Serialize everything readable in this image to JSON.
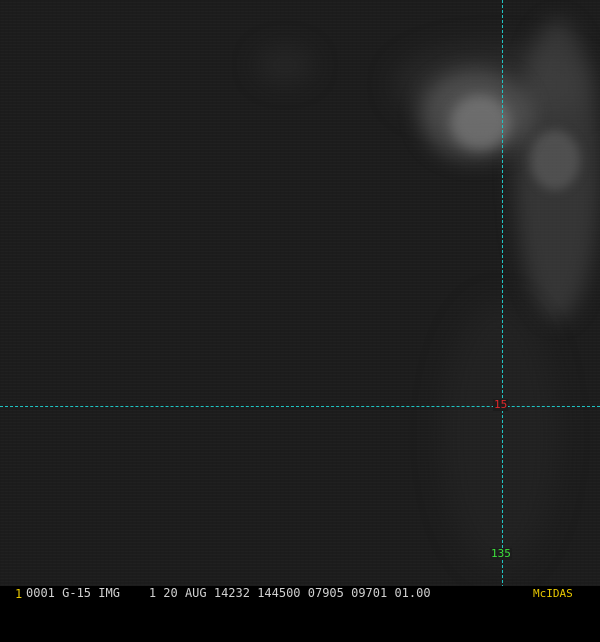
{
  "image": {
    "type": "satellite-imagery",
    "colors": {
      "background": "#1c1c1c",
      "grid_line": "#1fc4c4",
      "latitude_label": "#e0282a",
      "longitude_label": "#3ce03c",
      "frame_number": "#e8c800",
      "brand": "#e8c800"
    }
  },
  "grid": {
    "latitude_label": "15",
    "longitude_label": "135"
  },
  "status_bar": {
    "frame_number": "1",
    "text": "0001 G-15 IMG    1 20 AUG 14232 144500 07905 09701 01.00",
    "brand": "McIDAS"
  }
}
